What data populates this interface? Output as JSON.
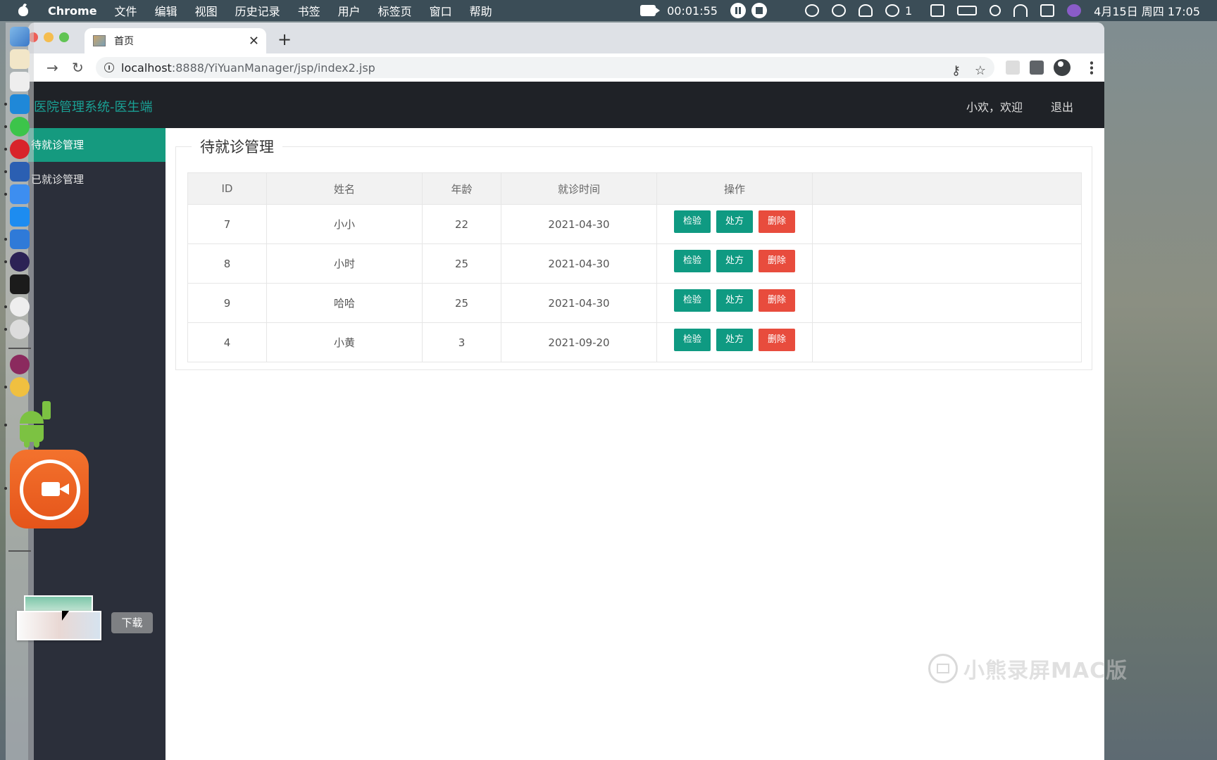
{
  "menubar": {
    "app_name": "Chrome",
    "items": [
      "文件",
      "编辑",
      "视图",
      "历史记录",
      "书签",
      "用户",
      "标签页",
      "窗口",
      "帮助"
    ],
    "recording_time": "00:01:55",
    "wechat_count": "1",
    "datetime": "4月15日 周四 17:05"
  },
  "browser": {
    "tab_title": "首页",
    "url_host": "localhost",
    "url_rest": ":8888/YiYuanManager/jsp/index2.jsp"
  },
  "app": {
    "title": "医院管理系统-医生端",
    "greeting": "小欢，欢迎",
    "logout": "退出",
    "sidebar": [
      {
        "label": "待就诊管理",
        "active": true
      },
      {
        "label": "已就诊管理",
        "active": false
      }
    ],
    "panel_title": "待就诊管理",
    "table": {
      "headers": [
        "ID",
        "姓名",
        "年龄",
        "就诊时间",
        "操作"
      ],
      "rows": [
        {
          "id": "7",
          "name": "小小",
          "age": "22",
          "date": "2021-04-30"
        },
        {
          "id": "8",
          "name": "小时",
          "age": "25",
          "date": "2021-04-30"
        },
        {
          "id": "9",
          "name": "哈哈",
          "age": "25",
          "date": "2021-04-30"
        },
        {
          "id": "4",
          "name": "小黄",
          "age": "3",
          "date": "2021-09-20"
        }
      ],
      "actions": {
        "inspect": "检验",
        "prescribe": "处方",
        "delete": "删除"
      }
    }
  },
  "download": {
    "label": "下载"
  },
  "watermark": "小熊录屏MAC版",
  "colors": {
    "accent": "#159a7f",
    "danger": "#e84c3d",
    "header_bg": "#1f2227",
    "sidebar_bg": "#2b2f3a"
  }
}
